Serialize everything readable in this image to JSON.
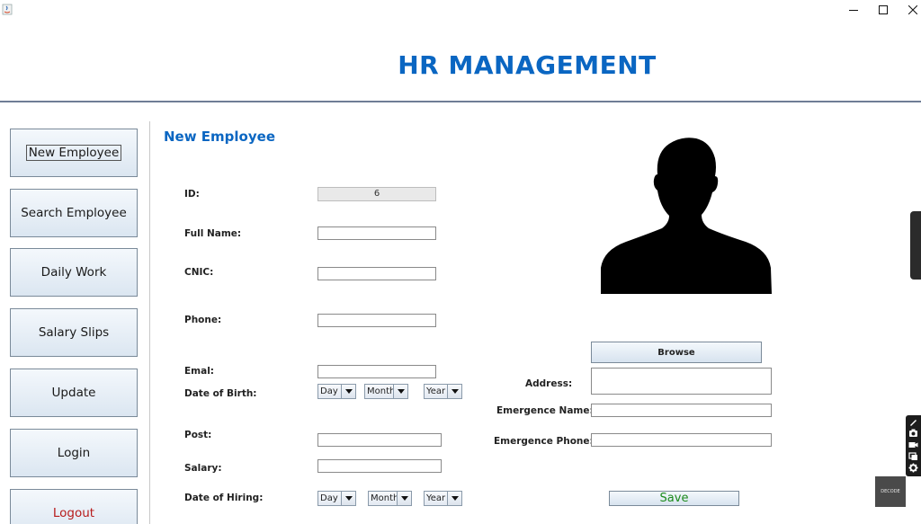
{
  "window": {
    "minimize_icon": "minimize-icon",
    "maximize_icon": "maximize-icon",
    "close_icon": "close-icon"
  },
  "header": {
    "title": "HR MANAGEMENT"
  },
  "sidebar": {
    "items": [
      {
        "label": "New Employee"
      },
      {
        "label": "Search Employee"
      },
      {
        "label": "Daily Work"
      },
      {
        "label": "Salary Slips"
      },
      {
        "label": "Update"
      },
      {
        "label": "Login"
      },
      {
        "label": "Logout"
      }
    ]
  },
  "form": {
    "title": "New Employee",
    "id": {
      "label": "ID:",
      "value": "6"
    },
    "full_name": {
      "label": "Full Name:",
      "value": ""
    },
    "cnic": {
      "label": "CNIC:",
      "value": ""
    },
    "phone": {
      "label": "Phone:",
      "value": ""
    },
    "email": {
      "label": "Emal:",
      "value": ""
    },
    "dob": {
      "label": "Date of Birth:",
      "day": "Day",
      "month": "Month",
      "year": "Year"
    },
    "post": {
      "label": "Post:",
      "value": ""
    },
    "salary": {
      "label": "Salary:",
      "value": ""
    },
    "hiring": {
      "label": "Date of Hiring:",
      "day": "Day",
      "month": "Month",
      "year": "Year"
    },
    "address": {
      "label": "Address:",
      "value": ""
    },
    "emergency_name": {
      "label": "Emergence Name:",
      "value": ""
    },
    "emergency_phone": {
      "label": "Emergence Phone:",
      "value": ""
    }
  },
  "photo": {
    "icon": "person-silhouette-icon"
  },
  "buttons": {
    "browse": "Browse",
    "save": "Save"
  },
  "overlay": {
    "watermark": "DECODE"
  },
  "colors": {
    "accent": "#0a66c2",
    "save_text": "#1b8a1b",
    "logout_text": "#b71c1c"
  }
}
